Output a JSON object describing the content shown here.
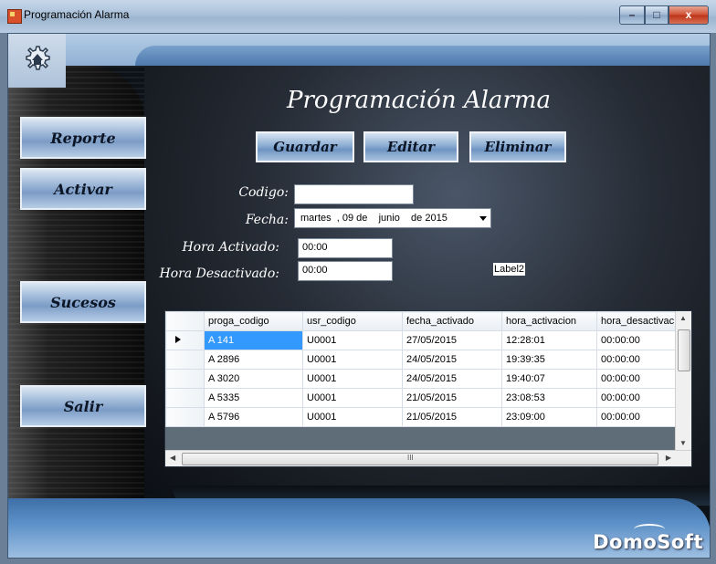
{
  "window": {
    "title": "Programación Alarma",
    "controls": {
      "minimize": "–",
      "maximize": "□",
      "close": "x"
    }
  },
  "sidebar": {
    "buttons": [
      {
        "label": "Reporte"
      },
      {
        "label": "Activar"
      },
      {
        "label": "Sucesos"
      },
      {
        "label": "Salir"
      }
    ]
  },
  "main": {
    "title": "Programación Alarma",
    "actions": {
      "save": "Guardar",
      "edit": "Editar",
      "delete": "Eliminar"
    },
    "form": {
      "codigo_label": "Codigo:",
      "codigo_value": "",
      "fecha_label": "Fecha:",
      "fecha_value": "martes  , 09 de    junio    de 2015",
      "hora_activado_label": "Hora Activado:",
      "hora_activado_value": "00:00",
      "hora_desactivado_label": "Hora Desactivado:",
      "hora_desactivado_value": "00:00",
      "label2": "Label2"
    },
    "grid": {
      "columns": [
        "proga_codigo",
        "usr_codigo",
        "fecha_activado",
        "hora_activacion",
        "hora_desactivac"
      ],
      "rows": [
        [
          "A 141",
          "U0001",
          "27/05/2015",
          "12:28:01",
          "00:00:00"
        ],
        [
          "A 2896",
          "U0001",
          "24/05/2015",
          "19:39:35",
          "00:00:00"
        ],
        [
          "A 3020",
          "U0001",
          "24/05/2015",
          "19:40:07",
          "00:00:00"
        ],
        [
          "A 5335",
          "U0001",
          "21/05/2015",
          "23:08:53",
          "00:00:00"
        ],
        [
          "A 5796",
          "U0001",
          "21/05/2015",
          "23:09:00",
          "00:00:00"
        ]
      ],
      "hscroll_label": "III"
    }
  },
  "brand": "DomoSoft"
}
